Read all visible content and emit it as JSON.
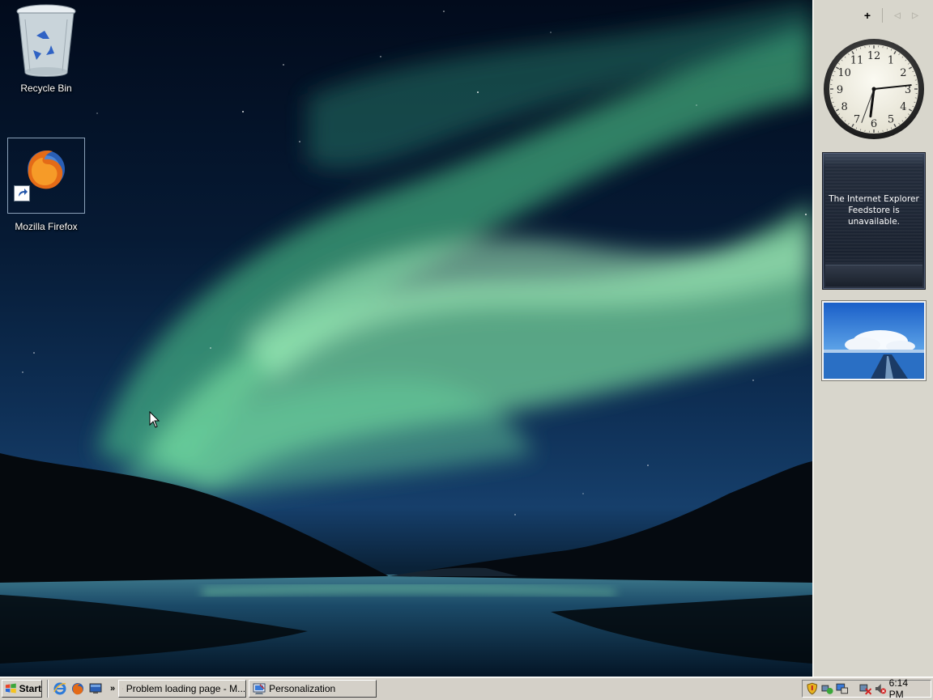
{
  "desktop": {
    "icons": [
      {
        "label": "Recycle Bin",
        "icon": "recycle-bin-icon"
      },
      {
        "label": "Mozilla Firefox",
        "icon": "firefox-icon"
      }
    ]
  },
  "sidebar": {
    "add_label": "+",
    "prev_label": "◁",
    "next_label": "▷",
    "clock": {
      "numerals": [
        "12",
        "1",
        "2",
        "3",
        "4",
        "5",
        "6",
        "7",
        "8",
        "9",
        "10",
        "11"
      ]
    },
    "feed_message": "The Internet Explorer Feedstore is unavailable."
  },
  "taskbar": {
    "start_label": "Start",
    "quick_launch": [
      "internet-explorer-icon",
      "firefox-icon",
      "show-desktop-icon"
    ],
    "more_label": "»",
    "tasks": [
      {
        "label": "Problem loading page - M...",
        "icon": "firefox-icon"
      },
      {
        "label": "Personalization",
        "icon": "personalization-icon"
      }
    ],
    "tray_icons": [
      "security-shield-icon",
      "network-icon",
      "display-icon",
      "network-disconnected-icon",
      "volume-muted-icon"
    ],
    "time": "6:14 PM"
  },
  "colors": {
    "aurora": "#7fe0a0",
    "taskbar": "#d4d0c8",
    "sidebar": "#d8d6cc"
  }
}
